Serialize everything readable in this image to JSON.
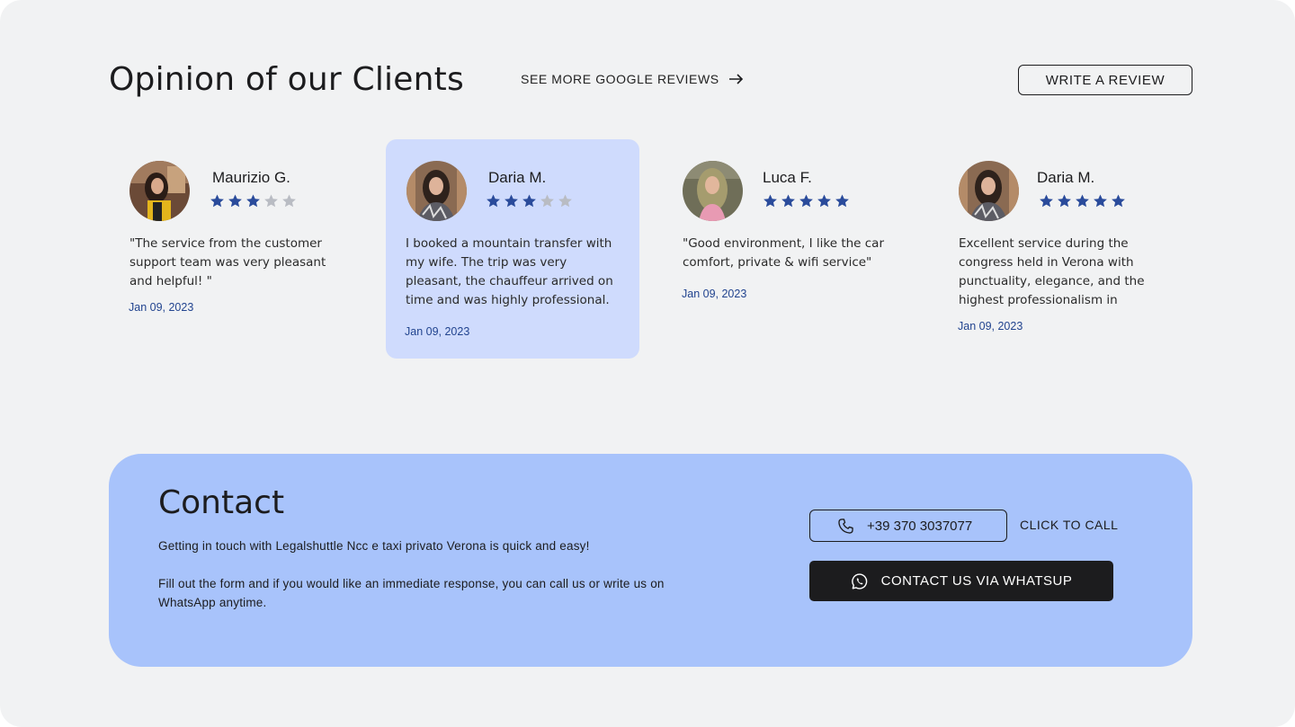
{
  "header": {
    "title": "Opinion of our Clients",
    "more_link": "SEE MORE GOOGLE REVIEWS",
    "write_review": "WRITE A REVIEW"
  },
  "colors": {
    "star_filled": "#2a4b9b",
    "star_empty": "#b9bcc3",
    "active_card": "#cfdbfd",
    "contact_bg": "#a8c3fb",
    "date": "#22448f"
  },
  "reviews": [
    {
      "name": "Maurizio G.",
      "rating": 3,
      "text": "\"The service from the customer support team was very pleasant and helpful! \"",
      "date": "Jan 09, 2023",
      "active": false
    },
    {
      "name": "Daria M.",
      "rating": 3,
      "text": "I booked a mountain transfer with my wife. The trip was very pleasant, the chauffeur arrived on time and was highly professional.",
      "date": "Jan 09, 2023",
      "active": true
    },
    {
      "name": "Luca F.",
      "rating": 5,
      "text": "\"Good environment, I like the car comfort, private & wifi service\"",
      "date": "Jan 09, 2023",
      "active": false
    },
    {
      "name": "Daria M.",
      "rating": 5,
      "text": "Excellent service during the congress held in Verona with punctuality, elegance, and the highest professionalism in",
      "date": "Jan 09, 2023",
      "active": false
    }
  ],
  "contact": {
    "title": "Contact",
    "line1": "Getting in touch with Legalshuttle Ncc e taxi privato Verona is quick and easy!",
    "line2": "Fill out the form and if you would like an immediate response, you can call us or write us on WhatsApp anytime.",
    "phone": "+39 370 3037077",
    "call_label": "CLICK TO CALL",
    "whatsapp_label": "CONTACT US VIA WHATSUP"
  }
}
